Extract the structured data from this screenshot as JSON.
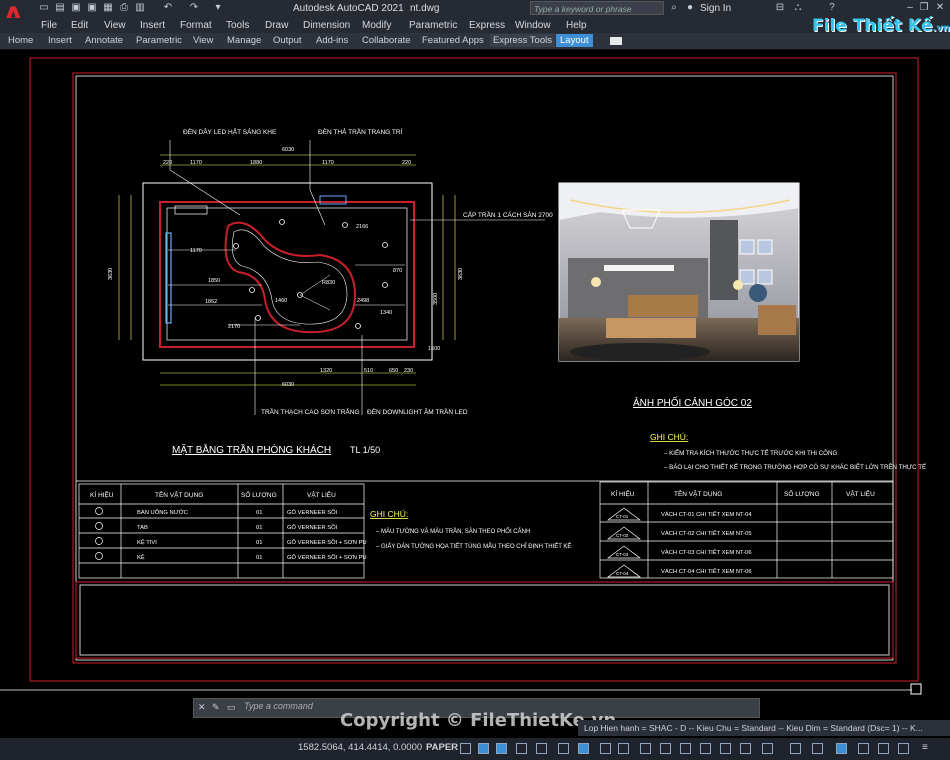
{
  "app": {
    "title": "Autodesk AutoCAD 2021",
    "filename": "nt.dwg",
    "search_placeholder": "Type a keyword or phrase",
    "sign_in": "Sign In",
    "brand": "File Thiết Kế",
    "brand_domain": ".vn"
  },
  "menu": [
    "File",
    "Edit",
    "View",
    "Insert",
    "Format",
    "Tools",
    "Draw",
    "Dimension",
    "Modify",
    "Parametric",
    "Express",
    "Window",
    "Help"
  ],
  "ribbon_tabs": [
    "Home",
    "Insert",
    "Annotate",
    "Parametric",
    "View",
    "Manage",
    "Output",
    "Add-ins",
    "Collaborate",
    "Featured Apps",
    "Express Tools",
    "Layout"
  ],
  "drawing": {
    "plan_title": "MẶT BẰNG TRẦN PHÒNG KHÁCH",
    "plan_scale": "TL 1/50",
    "photo_caption": "ẢNH PHỐI CẢNH GÓC 02",
    "callouts": {
      "led_strip": "ĐÈN DÂY LED HẮT SÁNG KHE",
      "pendant": "ĐÈN THẢ TRẦN TRANG TRÍ",
      "ceiling_level": "CẤP TRẦN 1 CÁCH SÀN 2700",
      "gypsum": "TRẦN THẠCH CAO SƠN TRẮNG",
      "downlight": "ĐÈN DOWNLIGHT ÂM TRẦN LED"
    },
    "dims_top": [
      "220",
      "1170",
      "1880",
      "1170",
      "220"
    ],
    "dim_total": "6030",
    "dims_bottom": [
      "1320",
      "510",
      "650",
      "230"
    ],
    "dim_bottom_total": "6030",
    "dim_left": "3630",
    "dim_right": "3630",
    "inner_dims": [
      "1170",
      "1850",
      "1862",
      "2170",
      "2166",
      "2498",
      "1340",
      "1460",
      "R830",
      "870",
      "3500",
      "1500"
    ],
    "notes_right": {
      "title": "GHI CHÚ:",
      "items": [
        "KIỂM TRA KÍCH THƯỚC THỰC TẾ TRƯỚC KHI THI CÔNG",
        "BÁO LẠI CHO THIẾT KẾ TRONG TRƯỜNG HỢP CÓ SỰ KHÁC BIỆT LỚN TRÊN THỰC TẾ"
      ]
    },
    "table_left": {
      "headers": [
        "KÍ HIỆU",
        "TÊN VẬT DỤNG",
        "SỐ LƯỢNG",
        "VẬT LIỆU"
      ],
      "rows": [
        [
          "BÀN UỐNG NƯỚC",
          "01",
          "GỖ VERNEER SỒI"
        ],
        [
          "TAB",
          "01",
          "GỖ VERNEER SỒI"
        ],
        [
          "KỆ TIVI",
          "01",
          "GỖ VERNEER SỒI + SƠN PU"
        ],
        [
          "KỆ",
          "01",
          "GỖ VERNEER SỒI + SƠN PU"
        ]
      ]
    },
    "notes_middle": {
      "title": "GHI CHÚ:",
      "items": [
        "MÀU TƯỜNG VÀ MÀU TRẦN, SÀN THEO PHỐI CẢNH",
        "GIẤY DÁN TƯỜNG HỌA TIẾT TÙNG MẪU THEO CHỈ ĐỊNH THIẾT KẾ"
      ]
    },
    "table_right": {
      "headers": [
        "KÍ HIỆU",
        "TÊN VẬT DỤNG",
        "SỐ LƯỢNG",
        "VẬT LIỆU"
      ],
      "rows": [
        [
          "CT-01",
          "VÁCH CT-01 CHI TIẾT XEM NT-04"
        ],
        [
          "CT-02",
          "VÁCH CT-02 CHI TIẾT XEM NT-05"
        ],
        [
          "CT-03",
          "VÁCH CT-03 CHI TIẾT XEM NT-06"
        ],
        [
          "CT-04",
          "VÁCH CT-04 CHI TIẾT XEM NT-06"
        ]
      ]
    }
  },
  "command": {
    "placeholder": "Type a command"
  },
  "layer_status": "Lop Hien hanh = SHAC - D -- Kieu Chu = Standard -- Kieu Dim = Standard (Dsc= 1) -- K...",
  "status": {
    "coords": "1582.5064, 414.4414, 0.0000",
    "space": "PAPER"
  },
  "watermark": "Copyright © FileThietKe.vn",
  "colors": {
    "accent": "#3d8fd6",
    "frame_red": "#c8202a",
    "logo_red": "#e0262e"
  }
}
